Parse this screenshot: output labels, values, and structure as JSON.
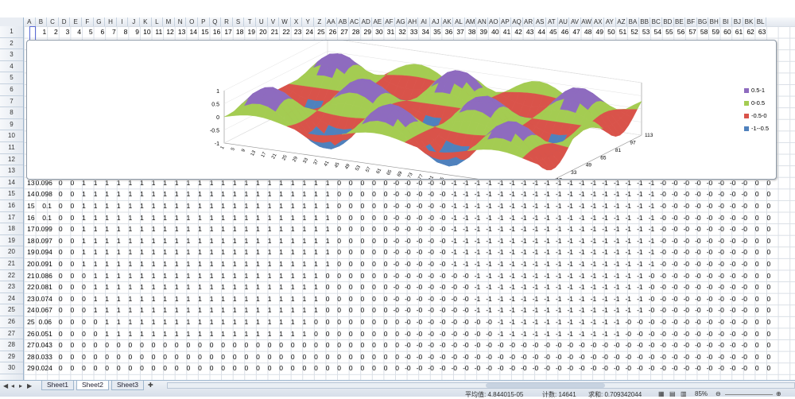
{
  "column_headers": [
    "A",
    "B",
    "C",
    "D",
    "E",
    "F",
    "G",
    "H",
    "I",
    "J",
    "K",
    "L",
    "M",
    "N",
    "O",
    "P",
    "Q",
    "R",
    "S",
    "T",
    "U",
    "V",
    "W",
    "X",
    "Y",
    "Z",
    "AA",
    "AB",
    "AC",
    "AD",
    "AE",
    "AF",
    "AG",
    "AH",
    "AI",
    "AJ",
    "AK",
    "AL",
    "AM",
    "AN",
    "AO",
    "AP",
    "AQ",
    "AR",
    "AS",
    "AT",
    "AU",
    "AV",
    "AW",
    "AX",
    "AY",
    "AZ",
    "BA",
    "BB",
    "BC",
    "BD",
    "BE",
    "BF",
    "BG",
    "BH",
    "BI",
    "BJ",
    "BK",
    "BL"
  ],
  "row_headers": [
    "1",
    "2",
    "3",
    "4",
    "5",
    "6",
    "7",
    "8",
    "9",
    "10",
    "11",
    "12",
    "13",
    "14",
    "15",
    "16",
    "17",
    "18",
    "19",
    "20",
    "21",
    "22",
    "23",
    "24",
    "25",
    "26",
    "27",
    "28",
    "29",
    "30"
  ],
  "row1_values": [
    "1",
    "2",
    "3",
    "4",
    "5",
    "6",
    "7",
    "8",
    "9",
    "10",
    "11",
    "12",
    "13",
    "14",
    "15",
    "16",
    "17",
    "18",
    "19",
    "20",
    "21",
    "22",
    "23",
    "24",
    "25",
    "26",
    "27",
    "28",
    "29",
    "30",
    "31",
    "32",
    "33",
    "34",
    "35",
    "36",
    "37",
    "38",
    "39",
    "40",
    "41",
    "42",
    "43",
    "44",
    "45",
    "46",
    "47",
    "48",
    "49",
    "50",
    "51",
    "52",
    "53",
    "54",
    "55",
    "56",
    "57",
    "58",
    "59",
    "60",
    "61",
    "62",
    "63"
  ],
  "data_rows": [
    {
      "row": "14",
      "a": "13",
      "b": "0.096",
      "pattern": "A"
    },
    {
      "row": "15",
      "a": "14",
      "b": "0.098",
      "pattern": "A"
    },
    {
      "row": "16",
      "a": "15",
      "b": "0.1",
      "pattern": "A"
    },
    {
      "row": "17",
      "a": "16",
      "b": "0.1",
      "pattern": "A"
    },
    {
      "row": "18",
      "a": "17",
      "b": "0.099",
      "pattern": "A"
    },
    {
      "row": "19",
      "a": "18",
      "b": "0.097",
      "pattern": "A"
    },
    {
      "row": "20",
      "a": "19",
      "b": "0.094",
      "pattern": "A"
    },
    {
      "row": "21",
      "a": "20",
      "b": "0.091",
      "pattern": "A"
    },
    {
      "row": "22",
      "a": "21",
      "b": "0.086",
      "pattern": "B"
    },
    {
      "row": "23",
      "a": "22",
      "b": "0.081",
      "pattern": "B"
    },
    {
      "row": "24",
      "a": "23",
      "b": "0.074",
      "pattern": "B"
    },
    {
      "row": "25",
      "a": "24",
      "b": "0.067",
      "pattern": "B"
    },
    {
      "row": "26",
      "a": "25",
      "b": "0.06",
      "pattern": "C"
    },
    {
      "row": "27",
      "a": "26",
      "b": "0.051",
      "pattern": "C"
    },
    {
      "row": "28",
      "a": "27",
      "b": "0.043",
      "pattern": "D"
    },
    {
      "row": "29",
      "a": "28",
      "b": "0.033",
      "pattern": "D"
    },
    {
      "row": "30",
      "a": "29",
      "b": "0.024",
      "pattern": "D"
    }
  ],
  "chart": {
    "z_ticks": [
      "1",
      "0.5",
      "0",
      "-0.5",
      "-1"
    ],
    "y_ticks": [
      "113",
      "97",
      "81",
      "65",
      "49",
      "33",
      "17"
    ],
    "x_ticks": [
      "1",
      "5",
      "9",
      "13",
      "17",
      "21",
      "25",
      "29",
      "33",
      "37",
      "41",
      "45",
      "49",
      "53",
      "57",
      "61",
      "65",
      "69",
      "73",
      "77",
      "81",
      "85",
      "89",
      "93",
      "97",
      "101",
      "105",
      "109",
      "113",
      "117",
      "121"
    ],
    "legend": [
      {
        "label": "0.5-1",
        "color": "#8e6bbf"
      },
      {
        "label": "0-0.5",
        "color": "#a4cc52"
      },
      {
        "label": "-0.5-0",
        "color": "#d9534a"
      },
      {
        "label": "-1--0.5",
        "color": "#4f81bd"
      }
    ]
  },
  "sheets": [
    "Sheet1",
    "Sheet2",
    "Sheet3"
  ],
  "active_sheet": "Sheet2",
  "status": {
    "average_label": "平均值: 4.844015-05",
    "count_label": "计数: 14641",
    "sum_label": "求和: 0.709342044",
    "zoom": "85%"
  }
}
